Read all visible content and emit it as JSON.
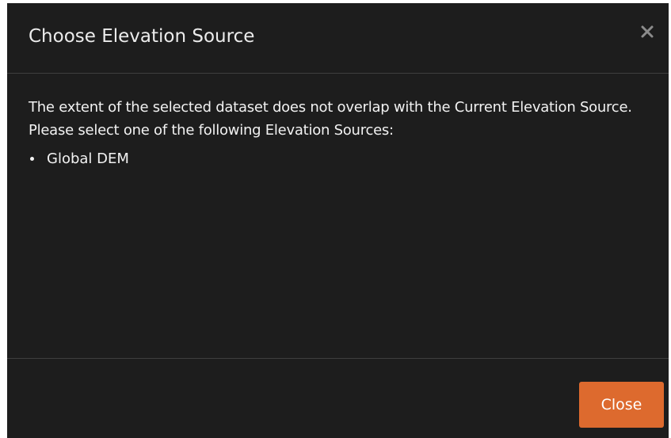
{
  "dialog": {
    "title": "Choose Elevation Source",
    "close_icon": "close-icon",
    "message": "The extent of the selected dataset does not overlap with the Current Elevation Source. Please select one of the following Elevation Sources:",
    "sources": [
      {
        "label": "Global DEM"
      }
    ],
    "close_button_label": "Close",
    "colors": {
      "background": "#1d1d1d",
      "divider": "#3e3e3e",
      "text": "#f2f2f2",
      "accent": "#dd6a2e"
    }
  }
}
